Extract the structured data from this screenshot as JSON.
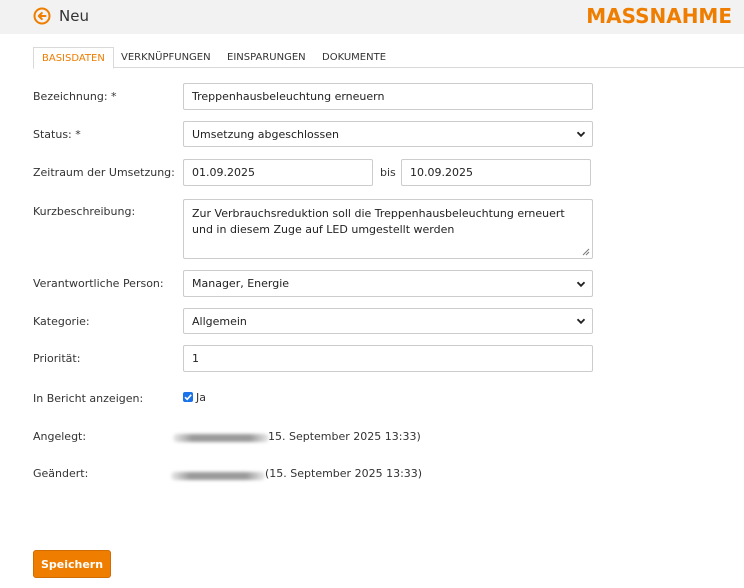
{
  "header": {
    "title": "Neu",
    "brand": "MASSNAHME",
    "back_icon": "arrow-left-circle-icon",
    "accent_color": "#ee7d00"
  },
  "tabs": [
    {
      "label": "BASISDATEN",
      "active": true
    },
    {
      "label": "VERKNÜPFUNGEN",
      "active": false
    },
    {
      "label": "EINSPARUNGEN",
      "active": false
    },
    {
      "label": "DOKUMENTE",
      "active": false
    }
  ],
  "form": {
    "bezeichnung": {
      "label": "Bezeichnung: *",
      "value": "Treppenhausbeleuchtung erneuern"
    },
    "status": {
      "label": "Status: *",
      "value": "Umsetzung abgeschlossen"
    },
    "zeitraum": {
      "label": "Zeitraum der Umsetzung:",
      "from": "01.09.2025",
      "separator": "bis",
      "to": "10.09.2025"
    },
    "kurzbeschreibung": {
      "label": "Kurzbeschreibung:",
      "value": "Zur Verbrauchsreduktion soll die Treppenhausbeleuchtung erneuert und in diesem Zuge auf LED umgestellt werden"
    },
    "verantwortlich": {
      "label": "Verantwortliche Person:",
      "value": "Manager, Energie"
    },
    "kategorie": {
      "label": "Kategorie:",
      "value": "Allgemein"
    },
    "prioritaet": {
      "label": "Priorität:",
      "value": "1"
    },
    "bericht": {
      "label": "In Bericht anzeigen:",
      "checked": true,
      "option_label": "Ja"
    },
    "angelegt": {
      "label": "Angelegt:",
      "value": "15. September 2025 13:33)"
    },
    "geaendert": {
      "label": "Geändert:",
      "value": "(15. September 2025 13:33)"
    }
  },
  "actions": {
    "save_label": "Speichern"
  }
}
